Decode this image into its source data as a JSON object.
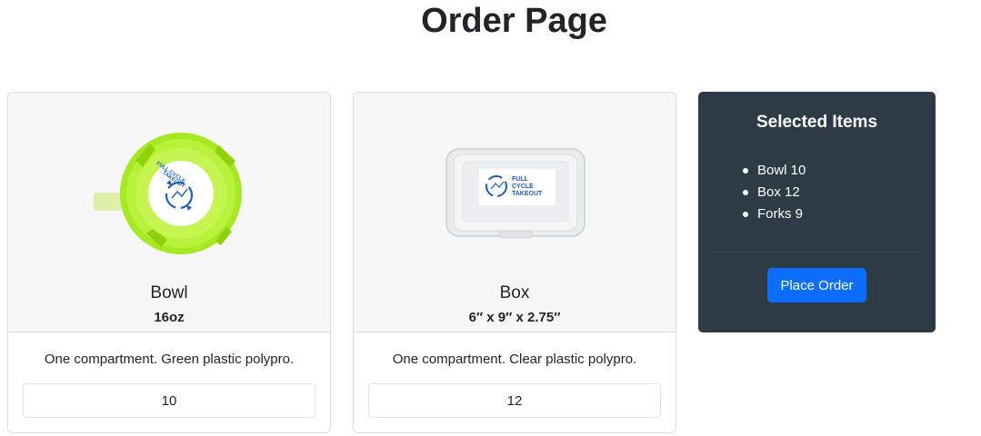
{
  "page": {
    "title": "Order Page"
  },
  "products": [
    {
      "name": "Bowl",
      "size": "16oz",
      "description": "One compartment. Green plastic polypro.",
      "quantity": "10",
      "image_label": [
        "FULL CYCLE",
        "TAKEOUT"
      ],
      "icon": "bowl-image"
    },
    {
      "name": "Box",
      "size": "6″ x 9″ x 2.75″",
      "description": "One compartment. Clear plastic polypro.",
      "quantity": "12",
      "image_label": [
        "FULL",
        "CYCLE",
        "TAKEOUT"
      ],
      "icon": "box-image"
    }
  ],
  "selected": {
    "title": "Selected Items",
    "items": [
      "Bowl 10",
      "Box 12",
      "Forks 9"
    ],
    "button_label": "Place Order"
  },
  "colors": {
    "panel_bg": "#2d3b45",
    "button_bg": "#0d6efd",
    "bowl_green": "#9ee31a",
    "logo_blue": "#1d5fb8"
  }
}
